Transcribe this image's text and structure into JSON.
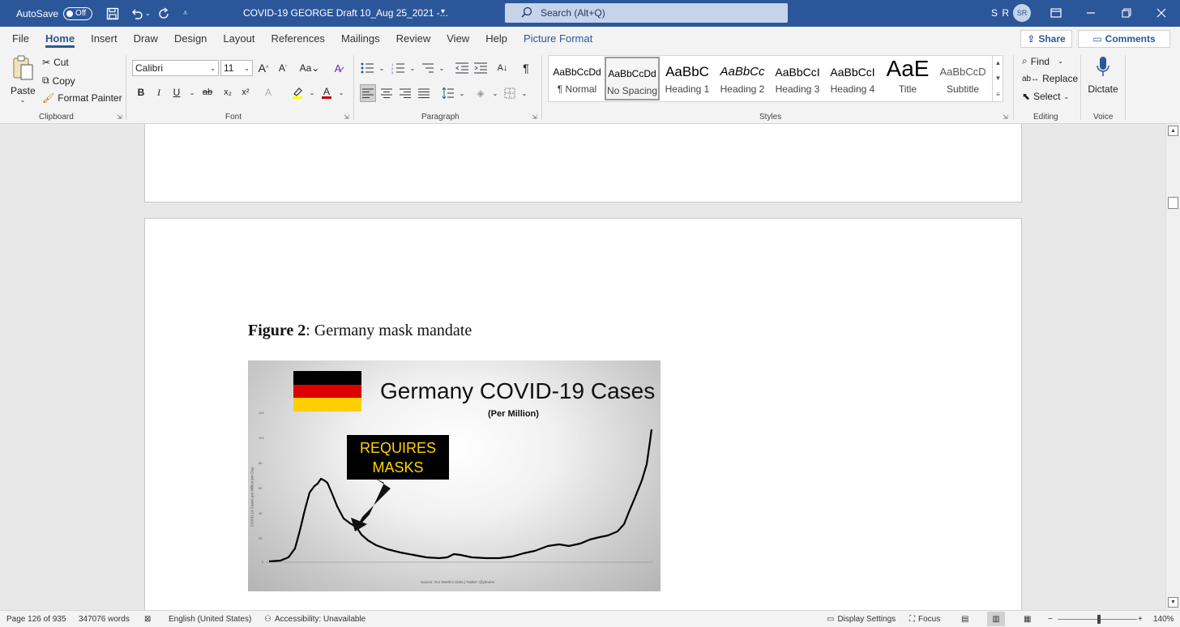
{
  "titlebar": {
    "autosave_label": "AutoSave",
    "autosave_state": "Off",
    "document_title": "COVID-19 GEORGE Draft 10_Aug 25_2021  -...",
    "search_placeholder": "Search (Alt+Q)",
    "user_initials": "S R",
    "avatar_text": "SR"
  },
  "tabs": [
    "File",
    "Home",
    "Insert",
    "Draw",
    "Design",
    "Layout",
    "References",
    "Mailings",
    "Review",
    "View",
    "Help",
    "Picture Format"
  ],
  "active_tab": "Home",
  "share_label": "Share",
  "comments_label": "Comments",
  "clipboard": {
    "paste": "Paste",
    "cut": "Cut",
    "copy": "Copy",
    "format_painter": "Format Painter",
    "group": "Clipboard"
  },
  "font": {
    "name": "Calibri",
    "size": "11",
    "group": "Font"
  },
  "paragraph": {
    "group": "Paragraph"
  },
  "styles": {
    "group": "Styles",
    "items": [
      {
        "preview": "AaBbCcDd",
        "name": "¶ Normal"
      },
      {
        "preview": "AaBbCcDd",
        "name": "No Spacing"
      },
      {
        "preview": "AaBbC",
        "name": "Heading 1"
      },
      {
        "preview": "AaBbCc",
        "name": "Heading 2"
      },
      {
        "preview": "AaBbCcI",
        "name": "Heading 3"
      },
      {
        "preview": "AaBbCcI",
        "name": "Heading 4"
      },
      {
        "preview": "AaE",
        "name": "Title"
      },
      {
        "preview": "AaBbCcD",
        "name": "Subtitle"
      }
    ]
  },
  "editing": {
    "find": "Find",
    "replace": "Replace",
    "select": "Select",
    "group": "Editing"
  },
  "voice": {
    "dictate": "Dictate",
    "group": "Voice"
  },
  "document": {
    "caption_bold": "Figure 2",
    "caption_rest": ": Germany mask mandate",
    "figure": {
      "title": "Germany COVID-19 Cases",
      "subtitle": "(Per Million)",
      "annotation_line1": "REQUIRES",
      "annotation_line2": "MASKS",
      "y_ticks": [
        "120",
        "100",
        "80",
        "60",
        "40",
        "20",
        "0"
      ],
      "y_label": "COVID-19 Cases per Million per Day",
      "source": "Source: Our World in Data  |  Twitter: @ylmone",
      "flag_colors": [
        "#000000",
        "#dd0000",
        "#ffce00"
      ],
      "annotation_text_color": "#ffd400"
    }
  },
  "statusbar": {
    "page": "Page 126 of 935",
    "words": "347076 words",
    "language": "English (United States)",
    "accessibility": "Accessibility: Unavailable",
    "display_settings": "Display Settings",
    "focus": "Focus",
    "zoom": "140%"
  },
  "colors": {
    "accent": "#2b579a"
  }
}
